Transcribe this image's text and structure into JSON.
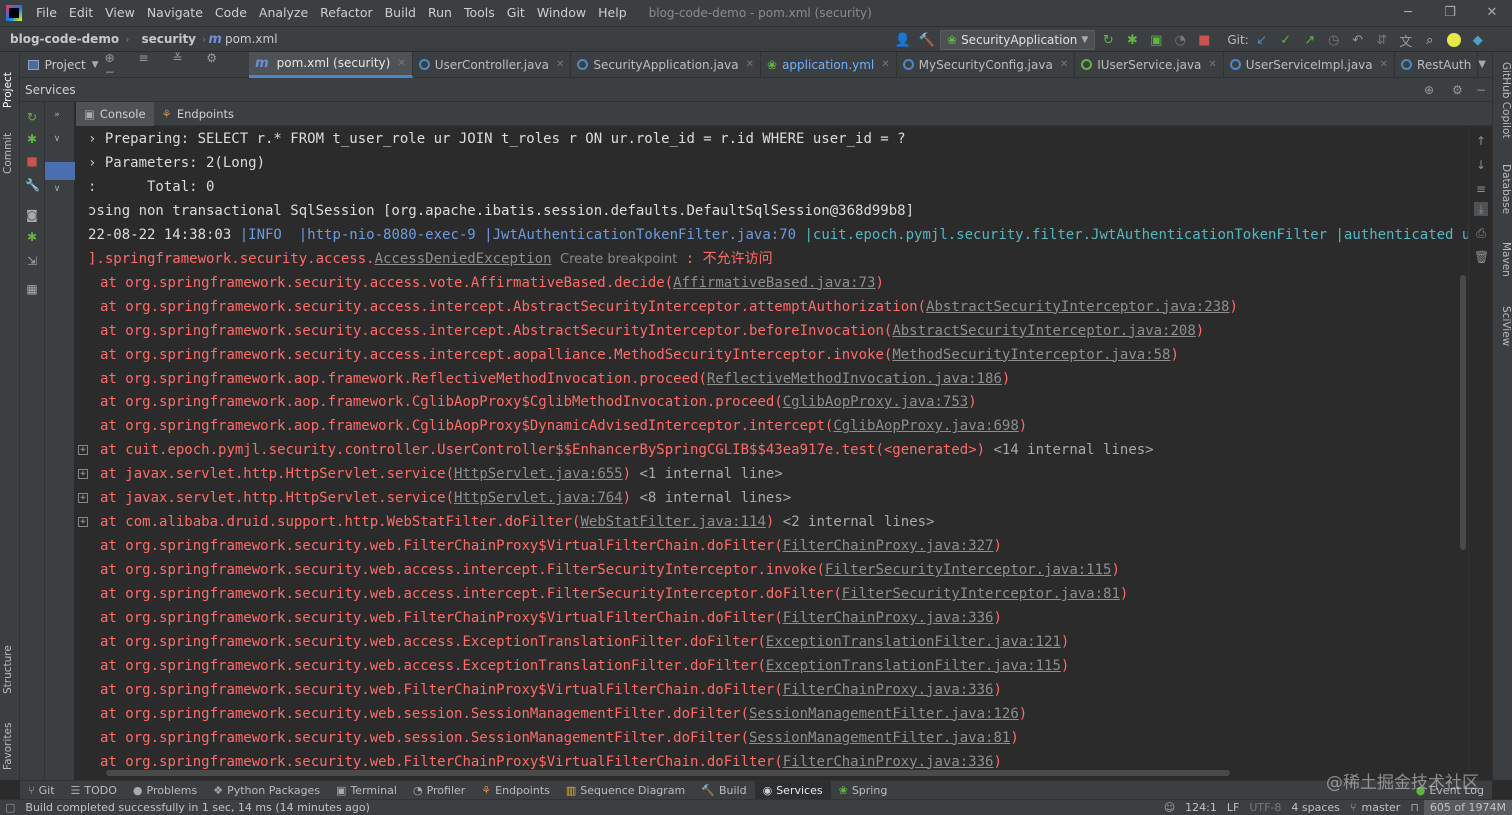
{
  "menu": {
    "items": [
      "File",
      "Edit",
      "View",
      "Navigate",
      "Code",
      "Analyze",
      "Refactor",
      "Build",
      "Run",
      "Tools",
      "Git",
      "Window",
      "Help"
    ],
    "window_title": "blog-code-demo - pom.xml (security)"
  },
  "navbar": {
    "project": "blog-code-demo",
    "module": "security",
    "file": "pom.xml",
    "run_config": "SecurityApplication",
    "git_label": "Git:"
  },
  "left_strip": {
    "tabs": [
      "Project",
      "Commit",
      "Structure",
      "Favorites"
    ]
  },
  "right_strip": {
    "tabs": [
      "GitHub Copilot",
      "Database",
      "Maven",
      "SciView"
    ]
  },
  "project_panel": {
    "title": "Project"
  },
  "editor_tabs": [
    {
      "label": "pom.xml (security)",
      "color": "#6f8ed6",
      "active": true,
      "kind": "m"
    },
    {
      "label": "UserController.java",
      "color": "#4a88c7",
      "active": false,
      "kind": "c"
    },
    {
      "label": "SecurityApplication.java",
      "color": "#4a88c7",
      "active": false,
      "kind": "c"
    },
    {
      "label": "application.yml",
      "color": "#62b543",
      "active": false,
      "kind": "yml"
    },
    {
      "label": "MySecurityConfig.java",
      "color": "#4a88c7",
      "active": false,
      "kind": "c"
    },
    {
      "label": "IUserService.java",
      "color": "#62b543",
      "active": false,
      "kind": "i"
    },
    {
      "label": "UserServiceImpl.java",
      "color": "#4a88c7",
      "active": false,
      "kind": "c"
    },
    {
      "label": "RestAuth",
      "color": "#4a88c7",
      "active": false,
      "kind": "c"
    }
  ],
  "services": {
    "title": "Services",
    "tabs": [
      {
        "label": "Console",
        "active": true
      },
      {
        "label": "Endpoints",
        "active": false
      }
    ]
  },
  "console_lines": [
    {
      "type": "plain",
      "prefix": "› ",
      "text": "Preparing: SELECT r.* FROM t_user_role ur JOIN t_roles r ON ur.role_id = r.id WHERE user_id = ?"
    },
    {
      "type": "plain",
      "prefix": "› ",
      "text": "Parameters: 2(Long)"
    },
    {
      "type": "plain",
      "prefix": ": ",
      "text": "     Total: 0"
    },
    {
      "type": "plain",
      "prefix": "",
      "text": "ɔsing non transactional SqlSession [org.apache.ibatis.session.defaults.DefaultSqlSession@368d99b8]"
    },
    {
      "type": "log",
      "date": "22-08-22 14:38:03 ",
      "level": "|INFO  ",
      "thread": "|http-nio-8080-exec-9 ",
      "src": "|JwtAuthenticationTokenFilter.java:70 ",
      "cls": "|cuit.epoch.pymjl.security.filter.JwtAuthenticationTokenFilter ",
      "msg": "|authenticated user"
    },
    {
      "type": "exception",
      "pre": "].springframework.security.access.",
      "link": "AccessDeniedException",
      "hint": "Create breakpoint",
      "msg": " : 不允许访问"
    },
    {
      "type": "at",
      "fold": false,
      "method": "org.springframework.security.access.vote.AffirmativeBased.decide",
      "loc": "AffirmativeBased.java:73",
      "tail": ""
    },
    {
      "type": "at",
      "fold": false,
      "method": "org.springframework.security.access.intercept.AbstractSecurityInterceptor.attemptAuthorization",
      "loc": "AbstractSecurityInterceptor.java:238",
      "tail": ""
    },
    {
      "type": "at",
      "fold": false,
      "method": "org.springframework.security.access.intercept.AbstractSecurityInterceptor.beforeInvocation",
      "loc": "AbstractSecurityInterceptor.java:208",
      "tail": ""
    },
    {
      "type": "at",
      "fold": false,
      "method": "org.springframework.security.access.intercept.aopalliance.MethodSecurityInterceptor.invoke",
      "loc": "MethodSecurityInterceptor.java:58",
      "tail": ""
    },
    {
      "type": "at",
      "fold": false,
      "method": "org.springframework.aop.framework.ReflectiveMethodInvocation.proceed",
      "loc": "ReflectiveMethodInvocation.java:186",
      "tail": ""
    },
    {
      "type": "at",
      "fold": false,
      "method": "org.springframework.aop.framework.CglibAopProxy$CglibMethodInvocation.proceed",
      "loc": "CglibAopProxy.java:753",
      "tail": ""
    },
    {
      "type": "at",
      "fold": false,
      "method": "org.springframework.aop.framework.CglibAopProxy$DynamicAdvisedInterceptor.intercept",
      "loc": "CglibAopProxy.java:698",
      "tail": ""
    },
    {
      "type": "atgen",
      "fold": true,
      "method": "cuit.epoch.pymjl.security.controller.UserController$$EnhancerBySpringCGLIB$$43ea917e.test(<generated>)",
      "tail": " <14 internal lines>"
    },
    {
      "type": "at",
      "fold": true,
      "method": "javax.servlet.http.HttpServlet.service",
      "loc": "HttpServlet.java:655",
      "tail": " <1 internal line>"
    },
    {
      "type": "at",
      "fold": true,
      "method": "javax.servlet.http.HttpServlet.service",
      "loc": "HttpServlet.java:764",
      "tail": " <8 internal lines>"
    },
    {
      "type": "at",
      "fold": true,
      "method": "com.alibaba.druid.support.http.WebStatFilter.doFilter",
      "loc": "WebStatFilter.java:114",
      "tail": " <2 internal lines>"
    },
    {
      "type": "at",
      "fold": false,
      "method": "org.springframework.security.web.FilterChainProxy$VirtualFilterChain.doFilter",
      "loc": "FilterChainProxy.java:327",
      "tail": ""
    },
    {
      "type": "at",
      "fold": false,
      "method": "org.springframework.security.web.access.intercept.FilterSecurityInterceptor.invoke",
      "loc": "FilterSecurityInterceptor.java:115",
      "tail": ""
    },
    {
      "type": "at",
      "fold": false,
      "method": "org.springframework.security.web.access.intercept.FilterSecurityInterceptor.doFilter",
      "loc": "FilterSecurityInterceptor.java:81",
      "tail": ""
    },
    {
      "type": "at",
      "fold": false,
      "method": "org.springframework.security.web.FilterChainProxy$VirtualFilterChain.doFilter",
      "loc": "FilterChainProxy.java:336",
      "tail": ""
    },
    {
      "type": "at",
      "fold": false,
      "method": "org.springframework.security.web.access.ExceptionTranslationFilter.doFilter",
      "loc": "ExceptionTranslationFilter.java:121",
      "tail": ""
    },
    {
      "type": "at",
      "fold": false,
      "method": "org.springframework.security.web.access.ExceptionTranslationFilter.doFilter",
      "loc": "ExceptionTranslationFilter.java:115",
      "tail": ""
    },
    {
      "type": "at",
      "fold": false,
      "method": "org.springframework.security.web.FilterChainProxy$VirtualFilterChain.doFilter",
      "loc": "FilterChainProxy.java:336",
      "tail": ""
    },
    {
      "type": "at",
      "fold": false,
      "method": "org.springframework.security.web.session.SessionManagementFilter.doFilter",
      "loc": "SessionManagementFilter.java:126",
      "tail": ""
    },
    {
      "type": "at",
      "fold": false,
      "method": "org.springframework.security.web.session.SessionManagementFilter.doFilter",
      "loc": "SessionManagementFilter.java:81",
      "tail": ""
    },
    {
      "type": "at",
      "fold": false,
      "method": "org.springframework.security.web.FilterChainProxy$VirtualFilterChain.doFilter",
      "loc": "FilterChainProxy.java:336",
      "tail": ""
    }
  ],
  "bottom_tools": [
    {
      "label": "Git",
      "icon": "git-icon",
      "active": false
    },
    {
      "label": "TODO",
      "icon": "todo-icon",
      "active": false
    },
    {
      "label": "Problems",
      "icon": "problems-icon",
      "active": false
    },
    {
      "label": "Python Packages",
      "icon": "python-packages-icon",
      "active": false
    },
    {
      "label": "Terminal",
      "icon": "terminal-icon",
      "active": false
    },
    {
      "label": "Profiler",
      "icon": "profiler-icon",
      "active": false
    },
    {
      "label": "Endpoints",
      "icon": "endpoints-icon",
      "active": false
    },
    {
      "label": "Sequence Diagram",
      "icon": "sequence-diagram-icon",
      "active": false
    },
    {
      "label": "Build",
      "icon": "build-icon",
      "active": false
    },
    {
      "label": "Services",
      "icon": "services-icon",
      "active": true
    },
    {
      "label": "Spring",
      "icon": "spring-icon",
      "active": false
    }
  ],
  "event_log": "Event Log",
  "status": {
    "message": "Build completed successfully in 1 sec, 14 ms (14 minutes ago)",
    "position": "124:1",
    "line_sep": "LF",
    "encoding": "UTF-8",
    "indent": "4 spaces",
    "branch": "master",
    "memory": "605 of 1974M"
  },
  "watermark": "@稀土掘金技术社区"
}
